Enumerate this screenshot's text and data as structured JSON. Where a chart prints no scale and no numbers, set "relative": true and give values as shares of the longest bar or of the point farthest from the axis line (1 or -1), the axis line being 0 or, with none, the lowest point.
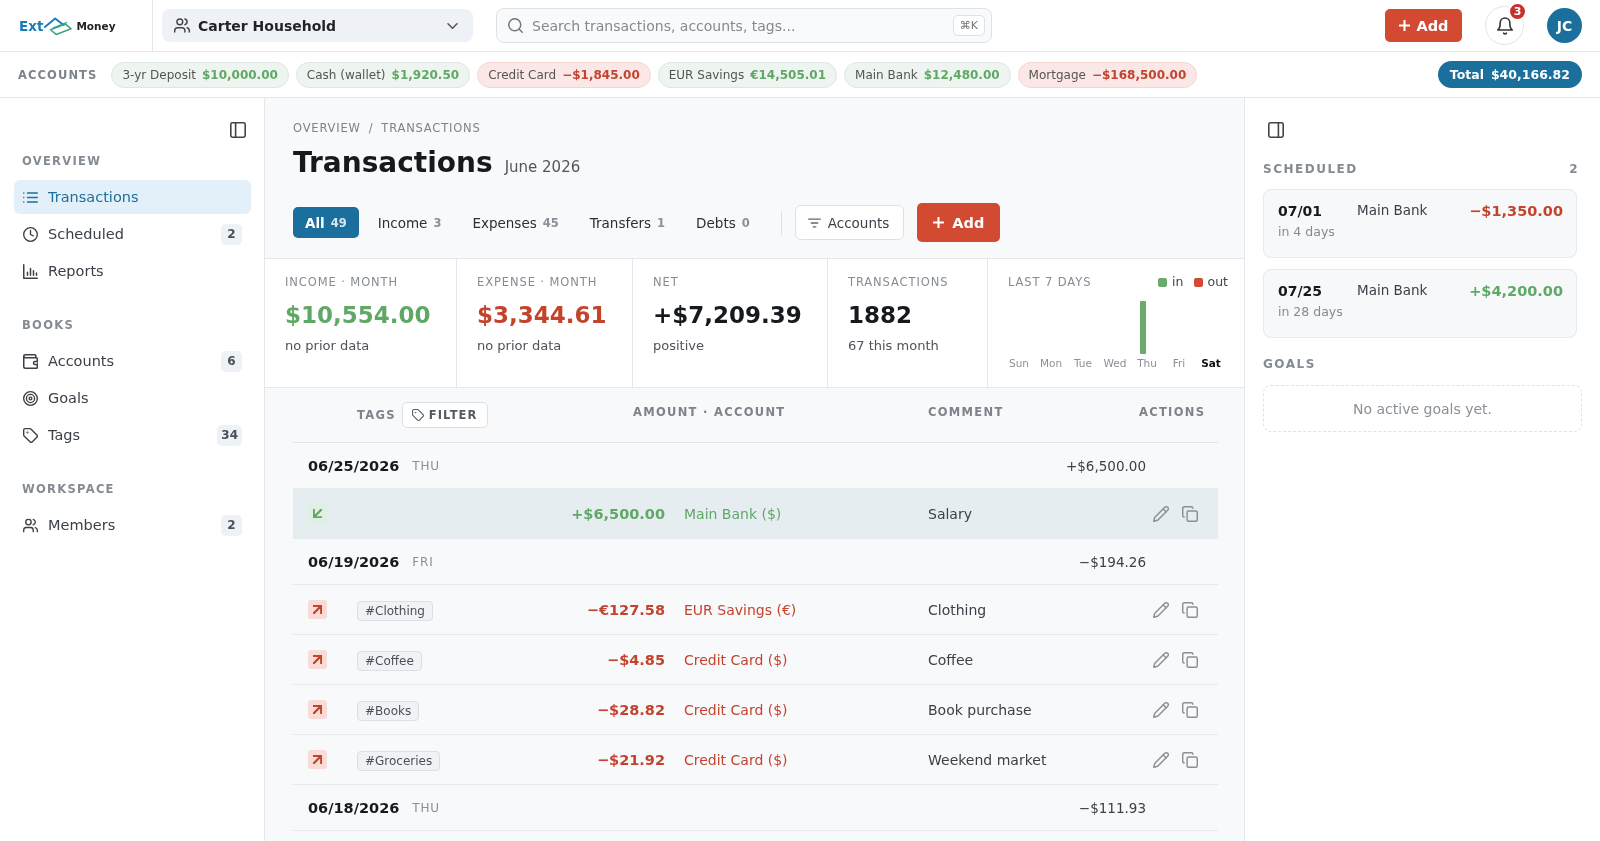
{
  "header": {
    "logo": {
      "prefix": "Ext",
      "suffix": "Money"
    },
    "household": "Carter Household",
    "search": {
      "placeholder": "Search transactions, accounts, tags...",
      "shortcut": "⌘K"
    },
    "add_button": "Add",
    "notifications": {
      "badge": "3"
    },
    "avatar": "JC"
  },
  "accounts_bar": {
    "label": "ACCOUNTS",
    "accounts": [
      {
        "name": "3-yr Deposit",
        "balance": "$10,000.00",
        "kind": "positive"
      },
      {
        "name": "Cash (wallet)",
        "balance": "$1,920.50",
        "kind": "positive"
      },
      {
        "name": "Credit Card",
        "balance": "−$1,845.00",
        "kind": "negative"
      },
      {
        "name": "EUR Savings",
        "balance": "€14,505.01",
        "kind": "positive"
      },
      {
        "name": "Main Bank",
        "balance": "$12,480.00",
        "kind": "positive"
      },
      {
        "name": "Mortgage",
        "balance": "−$168,500.00",
        "kind": "negative"
      }
    ],
    "total": {
      "label": "Total",
      "value": "$40,166.82"
    }
  },
  "sidebar": {
    "sections": [
      {
        "title": "OVERVIEW",
        "items": [
          {
            "label": "Transactions",
            "selected": true
          },
          {
            "label": "Scheduled",
            "count": "2",
            "selected": false
          },
          {
            "label": "Reports",
            "selected": false
          }
        ]
      },
      {
        "title": "BOOKS",
        "items": [
          {
            "label": "Accounts",
            "count": "6",
            "selected": false
          },
          {
            "label": "Goals",
            "selected": false
          },
          {
            "label": "Tags",
            "count": "34",
            "selected": false
          }
        ]
      },
      {
        "title": "WORKSPACE",
        "items": [
          {
            "label": "Members",
            "count": "2",
            "selected": false
          }
        ]
      }
    ]
  },
  "main": {
    "breadcrumb": {
      "items": [
        "OVERVIEW",
        "TRANSACTIONS"
      ],
      "separator": "/"
    },
    "title": "Transactions",
    "period": "June 2026",
    "tabs": [
      {
        "label": "All",
        "count": "49",
        "selected": true
      },
      {
        "label": "Income",
        "count": "3",
        "selected": false
      },
      {
        "label": "Expenses",
        "count": "45",
        "selected": false
      },
      {
        "label": "Transfers",
        "count": "1",
        "selected": false
      },
      {
        "label": "Debts",
        "count": "0",
        "selected": false
      }
    ],
    "accounts_filter": "Accounts",
    "add_button": "Add",
    "stats": [
      {
        "kind": "income",
        "label": "INCOME · MONTH",
        "value": "$10,554.00",
        "note": "no prior data"
      },
      {
        "kind": "expense",
        "label": "EXPENSE · MONTH",
        "value": "$3,344.61",
        "note": "no prior data"
      },
      {
        "kind": "net",
        "label": "NET",
        "value": "+$7,209.39",
        "note": "positive"
      },
      {
        "kind": "count",
        "label": "TRANSACTIONS",
        "value": "1882",
        "note": "67 this month"
      }
    ],
    "last_7_days": {
      "chart_data": {
        "type": "bar",
        "title": "LAST 7 DAYS",
        "relative": true,
        "categories": [
          "Sun",
          "Mon",
          "Tue",
          "Wed",
          "Thu",
          "Fri",
          "Sat"
        ],
        "series": [
          {
            "name": "in",
            "color": "#6aab6c",
            "values": [
              0,
              0,
              0,
              0,
              1,
              0,
              0
            ]
          },
          {
            "name": "out",
            "color": "#d14a31",
            "values": [
              0,
              0,
              0,
              0,
              0,
              0,
              0
            ]
          }
        ]
      },
      "categories_selected": [
        false,
        false,
        false,
        false,
        false,
        false,
        true
      ]
    },
    "table": {
      "columns": [
        {
          "label": "TAGS"
        },
        {
          "label": "AMOUNT · ACCOUNT"
        },
        {
          "label": "COMMENT"
        },
        {
          "label": "ACTIONS"
        }
      ],
      "tag_filter": "FILTER",
      "groups": [
        {
          "date": "06/25/2026",
          "weekday": "THU",
          "total": "+$6,500.00",
          "transactions": [
            {
              "kind": "income",
              "amount": "+$6,500.00",
              "account": "Main Bank ($)",
              "comment": "Salary",
              "selected": true
            }
          ]
        },
        {
          "date": "06/19/2026",
          "weekday": "FRI",
          "total": "−$194.26",
          "transactions": [
            {
              "kind": "expense",
              "tag": "#Clothing",
              "amount": "−€127.58",
              "account": "EUR Savings (€)",
              "comment": "Clothing",
              "selected": false
            },
            {
              "kind": "expense",
              "tag": "#Coffee",
              "amount": "−$4.85",
              "account": "Credit Card ($)",
              "comment": "Coffee",
              "selected": false
            },
            {
              "kind": "expense",
              "tag": "#Books",
              "amount": "−$28.82",
              "account": "Credit Card ($)",
              "comment": "Book purchase",
              "selected": false
            },
            {
              "kind": "expense",
              "tag": "#Groceries",
              "amount": "−$21.92",
              "account": "Credit Card ($)",
              "comment": "Weekend market",
              "selected": false
            }
          ]
        },
        {
          "date": "06/18/2026",
          "weekday": "THU",
          "total": "−$111.93"
        }
      ]
    }
  },
  "right_panel": {
    "scheduled": {
      "title": "SCHEDULED",
      "count": "2",
      "items": [
        {
          "date": "07/01",
          "relative": "in 4 days",
          "account": "Main Bank",
          "amount": "−$1,350.00",
          "kind": "expense"
        },
        {
          "date": "07/25",
          "relative": "in 28 days",
          "account": "Main Bank",
          "amount": "+$4,200.00",
          "kind": "income"
        }
      ]
    },
    "goals": {
      "title": "GOALS",
      "empty_text": "No active goals yet."
    }
  }
}
